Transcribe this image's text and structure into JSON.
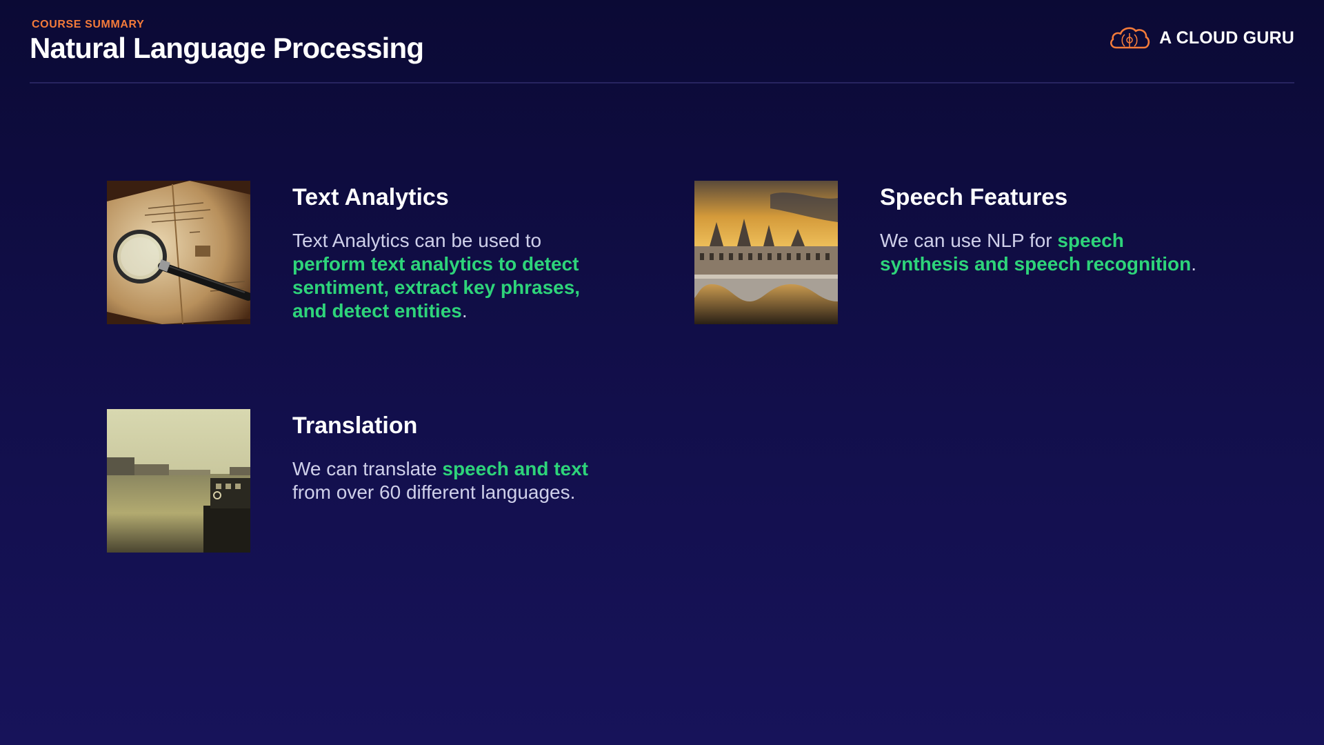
{
  "header": {
    "eyebrow": "COURSE SUMMARY",
    "title": "Natural Language Processing",
    "brand_icon": "cloud-logo-icon",
    "brand_name": "A CLOUD GURU"
  },
  "colors": {
    "background": "#110e48",
    "accent_orange": "#f47b3a",
    "highlight_green": "#2ed47a",
    "body_text": "#cfd0ea"
  },
  "cards": [
    {
      "image": "magnifying-glass-book-photo",
      "title": "Text Analytics",
      "text_before": "Text Analytics can be used to ",
      "highlight": "perform text analytics to detect sentiment, extract key phrases, and detect entities",
      "text_after": "."
    },
    {
      "image": "castle-bridge-sunset-photo",
      "title": "Speech Features",
      "text_before": "We can use NLP for ",
      "highlight": "speech synthesis and speech recognition",
      "text_after": "."
    },
    {
      "image": "river-boat-photo",
      "title": "Translation",
      "text_before": "We can translate ",
      "highlight": "speech and text",
      "text_after": " from over 60 different languages."
    }
  ]
}
